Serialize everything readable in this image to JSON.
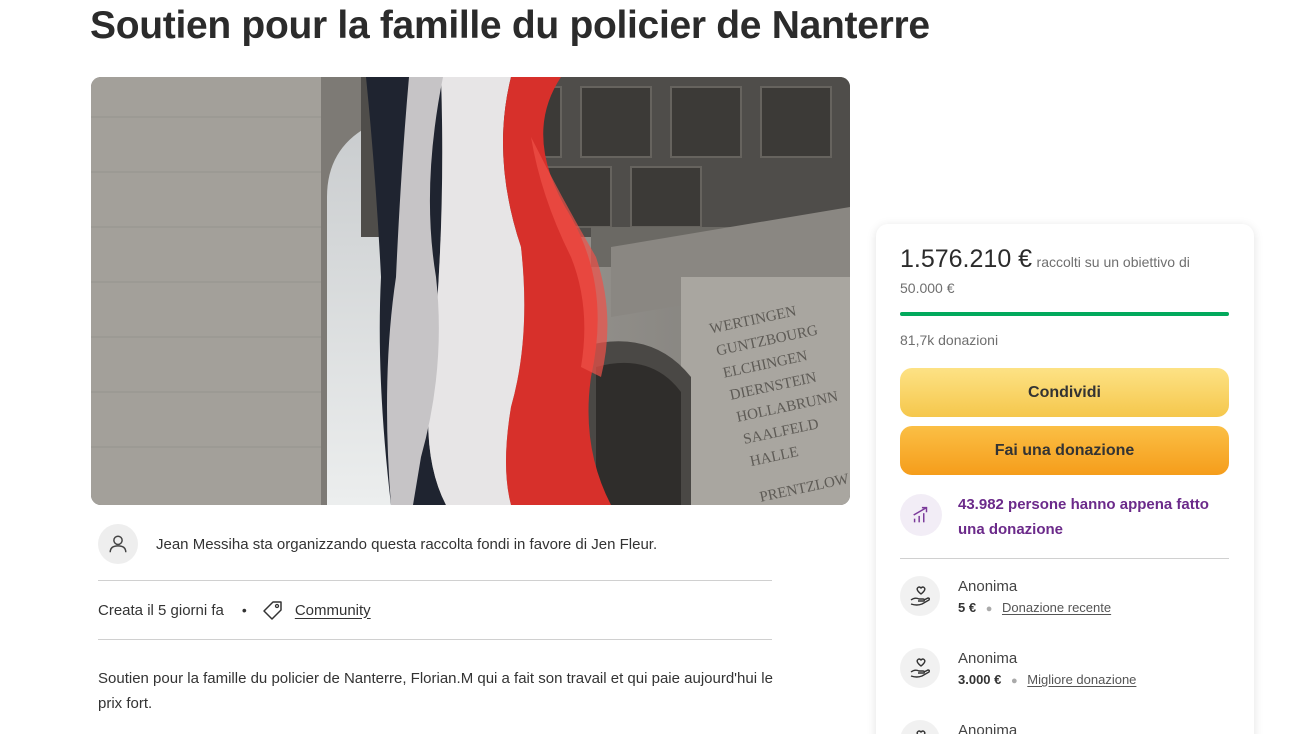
{
  "page": {
    "title": "Soutien pour la famille du policier de Nanterre"
  },
  "organizer": {
    "text": "Jean Messiha sta organizzando questa raccolta fondi in favore di Jen Fleur."
  },
  "meta": {
    "created": "Creata il 5 giorni fa",
    "separator": "•",
    "category": "Community"
  },
  "story": {
    "text": "Soutien pour la famille du policier de Nanterre, Florian.M qui a fait son travail et qui paie aujourd'hui le prix fort."
  },
  "donation_card": {
    "raised": "1.576.210 €",
    "raised_suffix": "raccolti su un obiettivo di",
    "goal": "50.000 €",
    "progress_fraction": 1.0,
    "donations_count": "81,7k donazioni",
    "share_label": "Condividi",
    "donate_label": "Fai una donazione",
    "trend_text": "43.982 persone hanno appena fatto una donazione",
    "donors": [
      {
        "name": "Anonima",
        "amount": "5 €",
        "tag": "Donazione recente"
      },
      {
        "name": "Anonima",
        "amount": "3.000 €",
        "tag": "Migliore donazione"
      },
      {
        "name": "Anonima"
      }
    ]
  },
  "colors": {
    "progress": "#02a95c",
    "share": "#f5c74c",
    "donate": "#f59d1b",
    "trend_text": "#6b2a8a"
  }
}
